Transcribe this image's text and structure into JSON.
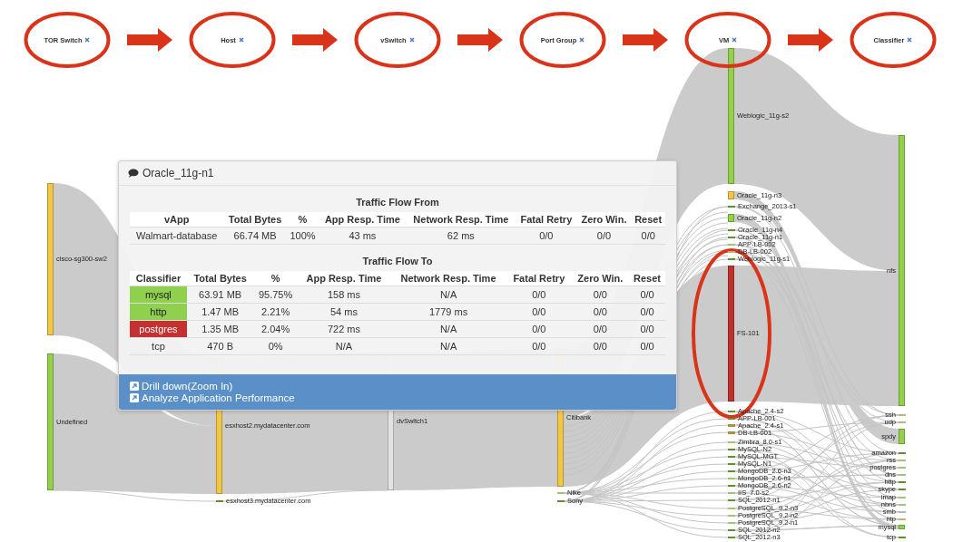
{
  "stages": [
    {
      "label": "TOR Switch",
      "circled": true
    },
    {
      "label": "Host",
      "circled": true
    },
    {
      "label": "vSwitch",
      "circled": true
    },
    {
      "label": "Port Group",
      "circled": true
    },
    {
      "label": "VM",
      "circled": true
    },
    {
      "label": "Classifier",
      "circled": true
    }
  ],
  "sankey": {
    "columns": [
      {
        "nodes": [
          {
            "label": "cisco-sg300-sw2",
            "color": "#f3c746",
            "circled": false
          },
          {
            "label": "Undefined",
            "color": "#94d14a",
            "circled": false
          }
        ]
      },
      {
        "nodes": [
          {
            "label": "esxhost2.mydatacenter.com",
            "color": "#f3c746",
            "circled": false
          },
          {
            "label": "esxhost3.mydatacenter.com",
            "color": "#5f8f2f",
            "circled": false
          }
        ]
      },
      {
        "nodes": [
          {
            "label": "dvSwitch1",
            "color": "#e2e2e2",
            "circled": false
          }
        ]
      },
      {
        "nodes": [
          {
            "label": "Citibank",
            "color": "#f3c746",
            "circled": false
          },
          {
            "label": "Nike",
            "color": "#a6c27a",
            "circled": false
          },
          {
            "label": "Sony",
            "color": "#5f8f2f",
            "circled": false
          }
        ]
      },
      {
        "nodes": [
          {
            "label": "Weblogic_11g-s2",
            "color": "#94d14a",
            "circled": false
          },
          {
            "label": "Oracle_11g-n3",
            "color": "#f3c746",
            "circled": false
          },
          {
            "label": "Exchange_2013-s1",
            "color": "#5f8f2f",
            "circled": false
          },
          {
            "label": "Oracle_11g-n2",
            "color": "#94d14a",
            "circled": false
          },
          {
            "label": "Oracle_11g-n4",
            "color": "#5f8f2f",
            "circled": false
          },
          {
            "label": "Oracle_11g-n1",
            "color": "#5f8f2f",
            "circled": false
          },
          {
            "label": "APP-LB-002",
            "color": "#a6c27a",
            "circled": false
          },
          {
            "label": "DB-LB-002",
            "color": "#a6c27a",
            "circled": false
          },
          {
            "label": "Weblogic_11g-s1",
            "color": "#5f8f2f",
            "circled": false
          },
          {
            "label": "FS-101",
            "color": "#c0302e",
            "circled": true
          },
          {
            "label": "Apache_2.4-s2",
            "color": "#5f8f2f",
            "circled": false
          },
          {
            "label": "APP-LB-001",
            "color": "#5f8f2f",
            "circled": false
          },
          {
            "label": "Apache_2.4-s1",
            "color": "#a8913a",
            "circled": false
          },
          {
            "label": "DB-LB-001",
            "color": "#a8913a",
            "circled": false
          },
          {
            "label": "Zimbra_8.0-s1",
            "color": "#a6c27a",
            "circled": false
          },
          {
            "label": "MySQL-N2",
            "color": "#5f8f2f",
            "circled": false
          },
          {
            "label": "MySQL-MGT",
            "color": "#5f8f2f",
            "circled": false
          },
          {
            "label": "MySQL-N1",
            "color": "#5f8f2f",
            "circled": false
          },
          {
            "label": "MongoDB_2.6-n3",
            "color": "#5f8f2f",
            "circled": false
          },
          {
            "label": "MongoDB_2.6-n1",
            "color": "#a6c27a",
            "circled": false
          },
          {
            "label": "MongoDB_2.6-n2",
            "color": "#5f8f2f",
            "circled": false
          },
          {
            "label": "IIS_7.0-s2",
            "color": "#a6c27a",
            "circled": false
          },
          {
            "label": "SQL_2012-n1",
            "color": "#5f8f2f",
            "circled": false
          },
          {
            "label": "PostgreSQL_9.2-n3",
            "color": "#a6c27a",
            "circled": false
          },
          {
            "label": "PostgreSQL_9.2-n2",
            "color": "#a6c27a",
            "circled": false
          },
          {
            "label": "PostgreSQL_9.2-n1",
            "color": "#a6c27a",
            "circled": false
          },
          {
            "label": "SQL_2012-n2",
            "color": "#5f8f2f",
            "circled": false
          },
          {
            "label": "SQL_2012-n3",
            "color": "#5f8f2f",
            "circled": false
          }
        ]
      },
      {
        "nodes": [
          {
            "label": "nfs",
            "color": "#94d14a",
            "circled": false
          },
          {
            "label": "ssh",
            "color": "#a6c27a",
            "circled": false
          },
          {
            "label": "udp",
            "color": "#a6c27a",
            "circled": false
          },
          {
            "label": "spdy",
            "color": "#94d14a",
            "circled": false
          },
          {
            "label": "amazon",
            "color": "#5f8f2f",
            "circled": false
          },
          {
            "label": "rss",
            "color": "#a6c27a",
            "circled": false
          },
          {
            "label": "postgres",
            "color": "#a6c27a",
            "circled": false
          },
          {
            "label": "dns",
            "color": "#a6c27a",
            "circled": false
          },
          {
            "label": "http",
            "color": "#5f8f2f",
            "circled": false
          },
          {
            "label": "skype",
            "color": "#5f8f2f",
            "circled": false
          },
          {
            "label": "imap",
            "color": "#a6c27a",
            "circled": false
          },
          {
            "label": "nbns",
            "color": "#a6c27a",
            "circled": false
          },
          {
            "label": "smb",
            "color": "#b5b5b5",
            "circled": false
          },
          {
            "label": "ntp",
            "color": "#a6c27a",
            "circled": false
          },
          {
            "label": "mysql",
            "color": "#94d14a",
            "circled": false
          },
          {
            "label": "tcp",
            "color": "#5f8f2f",
            "circled": false
          }
        ]
      }
    ]
  },
  "popup": {
    "title": "Oracle_11g-n1",
    "sections": [
      {
        "heading": "Traffic Flow From",
        "columns": [
          "vApp",
          "Total Bytes",
          "%",
          "App Resp. Time",
          "Network Resp. Time",
          "Fatal Retry",
          "Zero Win.",
          "Reset"
        ],
        "rows": [
          {
            "cells": [
              "Walmart-database",
              "66.74 MB",
              "100%",
              "43 ms",
              "62 ms",
              "0/0",
              "0/0",
              "0/0"
            ]
          }
        ]
      },
      {
        "heading": "Traffic Flow To",
        "columns": [
          "Classifier",
          "Total Bytes",
          "%",
          "App Resp. Time",
          "Network Resp. Time",
          "Fatal Retry",
          "Zero Win.",
          "Reset"
        ],
        "rows": [
          {
            "color": "#8fd14f",
            "cells": [
              "mysql",
              "63.91 MB",
              "95.75%",
              "158 ms",
              "N/A",
              "0/0",
              "0/0",
              "0/0"
            ]
          },
          {
            "color": "#8fd14f",
            "cells": [
              "http",
              "1.47 MB",
              "2.21%",
              "54 ms",
              "1779 ms",
              "0/0",
              "0/0",
              "0/0"
            ]
          },
          {
            "color": "#c53030",
            "cells": [
              "postgres",
              "1.35 MB",
              "2.04%",
              "722 ms",
              "N/A",
              "0/0",
              "0/0",
              "0/0"
            ]
          },
          {
            "cells": [
              "tcp",
              "470 B",
              "0%",
              "N/A",
              "N/A",
              "0/0",
              "0/0",
              "0/0"
            ]
          }
        ]
      }
    ],
    "actions": [
      "Drill down(Zoom In)",
      "Analyze Application Performance"
    ]
  }
}
